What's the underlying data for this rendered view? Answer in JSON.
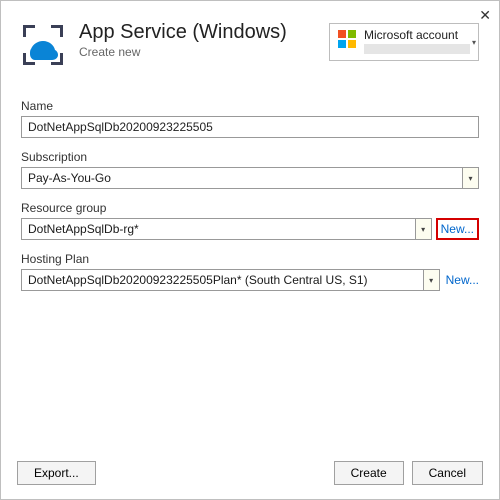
{
  "header": {
    "title": "App Service (Windows)",
    "subtitle": "Create new"
  },
  "account": {
    "label": "Microsoft account"
  },
  "fields": {
    "name": {
      "label": "Name",
      "value": "DotNetAppSqlDb20200923225505"
    },
    "subscription": {
      "label": "Subscription",
      "value": "Pay-As-You-Go"
    },
    "resource_group": {
      "label": "Resource group",
      "value": "DotNetAppSqlDb-rg*",
      "new_label": "New..."
    },
    "hosting_plan": {
      "label": "Hosting Plan",
      "value": "DotNetAppSqlDb20200923225505Plan* (South Central US, S1)",
      "new_label": "New..."
    }
  },
  "buttons": {
    "export": "Export...",
    "create": "Create",
    "cancel": "Cancel"
  }
}
